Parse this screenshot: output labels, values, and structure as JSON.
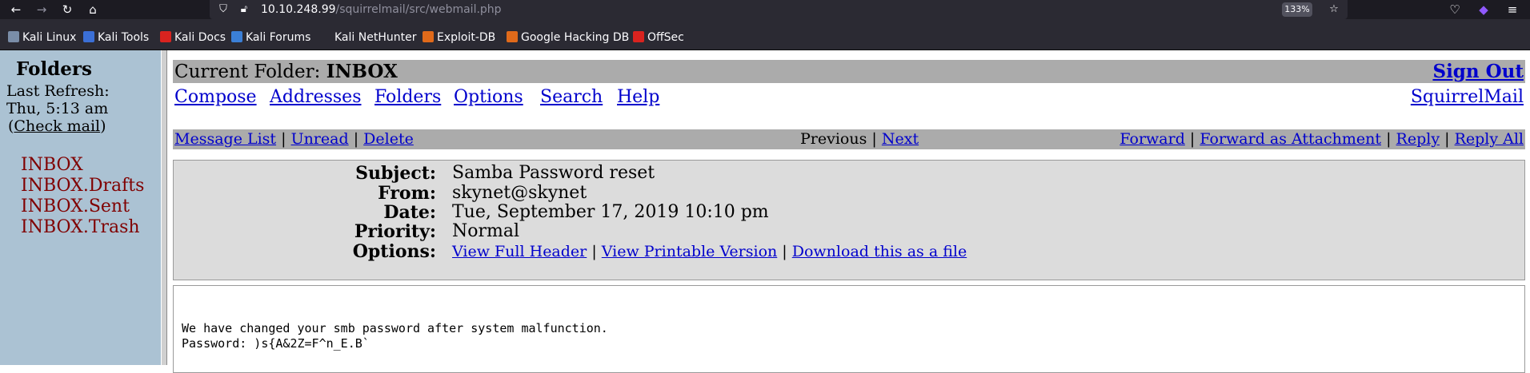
{
  "browser": {
    "url_host": "10.10.248.99",
    "url_path": "/squirrelmail/src/webmail.php",
    "zoom": "133%",
    "bookmarks": [
      {
        "label": "Kali Linux",
        "color": "#7a8da8"
      },
      {
        "label": "Kali Tools",
        "color": "#3b6fd6"
      },
      {
        "label": "Kali Docs",
        "color": "#d9231f"
      },
      {
        "label": "Kali Forums",
        "color": "#3b7fd6"
      },
      {
        "label": "Kali NetHunter",
        "color": "#2b2a33"
      },
      {
        "label": "Exploit-DB",
        "color": "#e06a1a"
      },
      {
        "label": "Google Hacking DB",
        "color": "#e06a1a"
      },
      {
        "label": "OffSec",
        "color": "#d9231f"
      }
    ]
  },
  "left": {
    "title": "Folders",
    "last_refresh_label": "Last Refresh:",
    "last_refresh_time": "Thu, 5:13 am",
    "check_mail_open": "(",
    "check_mail": "Check mail",
    "check_mail_close": ")",
    "folders": [
      "INBOX",
      "INBOX.Drafts",
      "INBOX.Sent",
      "INBOX.Trash"
    ]
  },
  "main": {
    "current_folder_label": "Current Folder:",
    "current_folder": "INBOX",
    "sign_out": "Sign Out",
    "menu": [
      "Compose",
      "Addresses",
      "Folders",
      "Options",
      "Search",
      "Help"
    ],
    "brand_link": "SquirrelMail",
    "nav": {
      "message_list": "Message List",
      "unread": "Unread",
      "delete": "Delete",
      "previous": "Previous",
      "next": "Next",
      "forward": "Forward",
      "forward_attachment": "Forward as Attachment",
      "reply": "Reply",
      "reply_all": "Reply All",
      "sep": "|"
    },
    "headers": {
      "subject_label": "Subject:",
      "subject": "Samba Password reset",
      "from_label": "From:",
      "from": "skynet@skynet",
      "date_label": "Date:",
      "date": "Tue, September 17, 2019 10:10 pm",
      "priority_label": "Priority:",
      "priority": "Normal",
      "options_label": "Options:",
      "view_full_header": "View Full Header",
      "view_printable": "View Printable Version",
      "download": "Download this as a file"
    },
    "body_lines": [
      "We have changed your smb password after system malfunction.",
      "Password: )s{A&2Z=F^n_E.B`"
    ]
  }
}
